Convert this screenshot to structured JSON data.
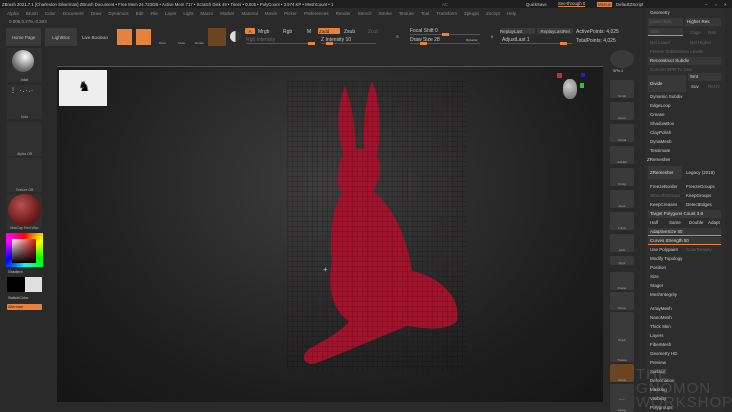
{
  "title_bar": {
    "text": "ZBrush 2021.7.1 [Charleston Silverman]   ZBrush Document    • Free Mem 24.723GB • Active Mem 717 • Scratch Disk 49 • Timer • 0.005 • PolyCount • 3.974 KP • MeshCount • 1",
    "ac": "AC",
    "quicksave": "QuickSave",
    "see_through": "See-through 0",
    "menus": "Menus",
    "default_zscript": "DefaultZScript"
  },
  "menu": [
    "Alpha",
    "Brush",
    "Color",
    "Document",
    "Draw",
    "Dynamics",
    "Edit",
    "File",
    "Layer",
    "Light",
    "Macro",
    "Marker",
    "Material",
    "Movie",
    "Picker",
    "Preferences",
    "Render",
    "Stencil",
    "Stroke",
    "Texture",
    "Tool",
    "Transform",
    "Zplugin",
    "Zscript",
    "Help"
  ],
  "coords": "0.006,0.276,-0.323",
  "toolbar": {
    "home": "Home Page",
    "lightbox": "LightBox",
    "live_boolean": "Live Boolean",
    "edit": "Edit",
    "draw": "Draw",
    "move": "Move",
    "scale": "Scale",
    "rotate": "Rotate",
    "a": "A",
    "mrgb": "Mrgb",
    "rgb": "Rgb",
    "m": "M",
    "zadd": "Zadd",
    "zsub": "Zsub",
    "zcut": "Zcut",
    "rgb_intensity": "Rgb Intensity",
    "z_intensity": "Z Intensity 10",
    "focal_shift": "Focal Shift 0",
    "draw_size": "Draw Size 28",
    "dynamic": "Dynamic",
    "replay_last": "ReplayLast",
    "replay_last_rel": "ReplayLastRel",
    "adjust_last": "AdjustLast 1",
    "active_points": "ActivePoints: 4,025",
    "total_points": "TotalPoints: 4,025",
    "s": "S",
    "zero": "0"
  },
  "left_shelf": {
    "brush": "Inflat",
    "stroke": "Dots",
    "alpha": "Alpha Off",
    "texture": "Texture Off",
    "material": "MatCap Red Wax",
    "gradient": "Gradient",
    "switch_color": "SwitchColor",
    "alternate": "Alternate"
  },
  "right_shelf": [
    "SPix 3",
    "Scroll",
    "Zoom",
    "Actual",
    "AAHalf",
    "Persp",
    "Floor",
    "L.Sym",
    "Lock",
    "Qxyz",
    "Frame",
    "Move",
    "Zoom3D",
    "Rotate",
    "PolyF",
    "Transp",
    "Ghost",
    "Solo",
    "Xpose"
  ],
  "right_panel": {
    "header": "Geometry",
    "lower_res": "Lower Res",
    "higher_res": "Higher Res",
    "sdiv": "SDiv",
    "cage": "Cage",
    "rstr": "Rstr",
    "del_lower": "Del Lower",
    "del_higher": "Del Higher",
    "freeze": "Freeze SubDivision Levels",
    "reconstruct": "Reconstruct Subdiv",
    "convert_bpr": "Convert BPR To Geo",
    "divide": "Divide",
    "smt": "Smt",
    "suv": "Suv",
    "reuv": "ReUV",
    "items1": [
      "Dynamic Subdiv",
      "EdgeLoop",
      "Crease",
      "ShadowBox",
      "ClayPolish",
      "DynaMesh",
      "Tessimate"
    ],
    "zremesher_header": "ZRemesher",
    "zremesher": "ZRemesher",
    "legacy": "Legacy (2018)",
    "freeze_border": "FreezeBorder",
    "freeze_groups": "FreezeGroups",
    "smooth_groups": "SmoothGroups",
    "keep_groups": "KeepGroups",
    "keep_creases": "KeepCreases",
    "detect_edges": "DetectEdges",
    "target_polys": "Target Polygons Count 3.8",
    "half": "Half",
    "same": "Same",
    "double": "Double",
    "adapt": "Adapt",
    "adaptive_size": "AdaptiveSize 50",
    "curves_strength": "Curves Strength 50",
    "use_polypaint": "Use Polypaint",
    "color_density": "ColorDensity",
    "items2": [
      "Modify Topology",
      "Position",
      "Size",
      "Stager",
      "MeshIntegrity"
    ],
    "items3": [
      "ArrayMesh",
      "NanoMesh",
      "Thick Skin",
      "Layers",
      "FiberMesh",
      "Geometry HD",
      "Preview",
      "Surface",
      "Deformation",
      "Masking",
      "Visibility",
      "Polygroups"
    ]
  },
  "watermark": "THE GNOMON WORKSHOP",
  "colors": {
    "accent": "#e8813a",
    "mesh": "#a0132c"
  }
}
